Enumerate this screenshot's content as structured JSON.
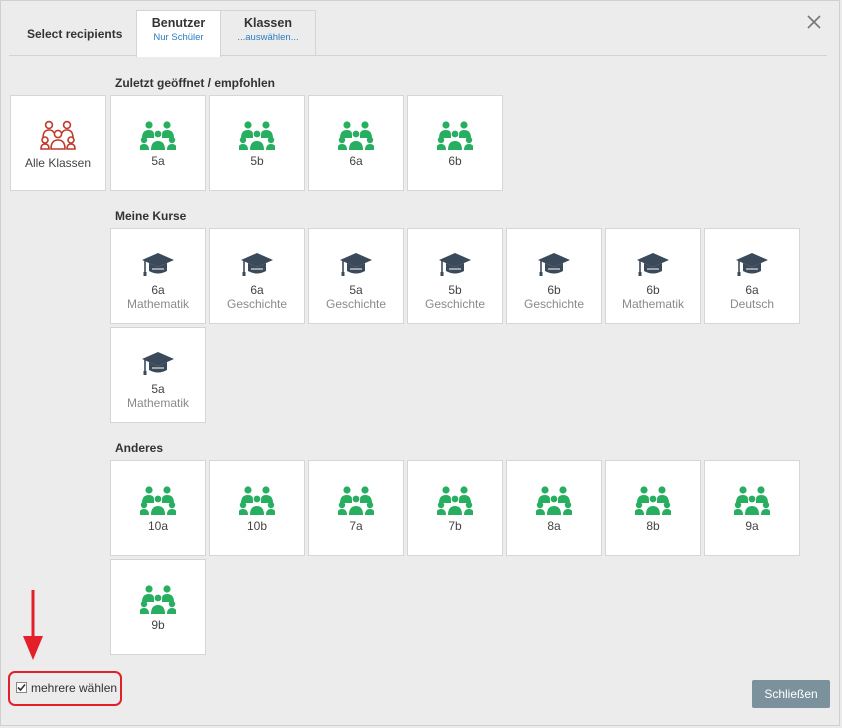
{
  "header": {
    "title": "Select recipients",
    "tabs": [
      {
        "label": "Benutzer",
        "sub": "Nur Schüler",
        "active": true
      },
      {
        "label": "Klassen",
        "sub": "...auswählen...",
        "active": false
      }
    ]
  },
  "sections": {
    "recent": {
      "label": "Zuletzt geöffnet / empfohlen",
      "all": {
        "label": "Alle Klassen",
        "icon": "group-outline-icon",
        "color": "#c0392b"
      },
      "items": [
        "5a",
        "5b",
        "6a",
        "6b"
      ]
    },
    "courses": {
      "label": "Meine Kurse",
      "items": [
        {
          "class": "6a",
          "subject": "Mathematik"
        },
        {
          "class": "6a",
          "subject": "Geschichte"
        },
        {
          "class": "5a",
          "subject": "Geschichte"
        },
        {
          "class": "5b",
          "subject": "Geschichte"
        },
        {
          "class": "6b",
          "subject": "Geschichte"
        },
        {
          "class": "6b",
          "subject": "Mathematik"
        },
        {
          "class": "6a",
          "subject": "Deutsch"
        },
        {
          "class": "5a",
          "subject": "Mathematik"
        }
      ]
    },
    "other": {
      "label": "Anderes",
      "items": [
        "10a",
        "10b",
        "7a",
        "7b",
        "8a",
        "8b",
        "9a",
        "9b"
      ]
    }
  },
  "footer": {
    "multi_select_label": "mehrere wählen",
    "multi_select_checked": true,
    "close_label": "Schließen"
  },
  "colors": {
    "group_icon": "#27ae60",
    "cap_icon": "#3b4a5a",
    "accent_link": "#2a7dc1",
    "highlight": "#e3202a",
    "close_button": "#7b919c"
  }
}
